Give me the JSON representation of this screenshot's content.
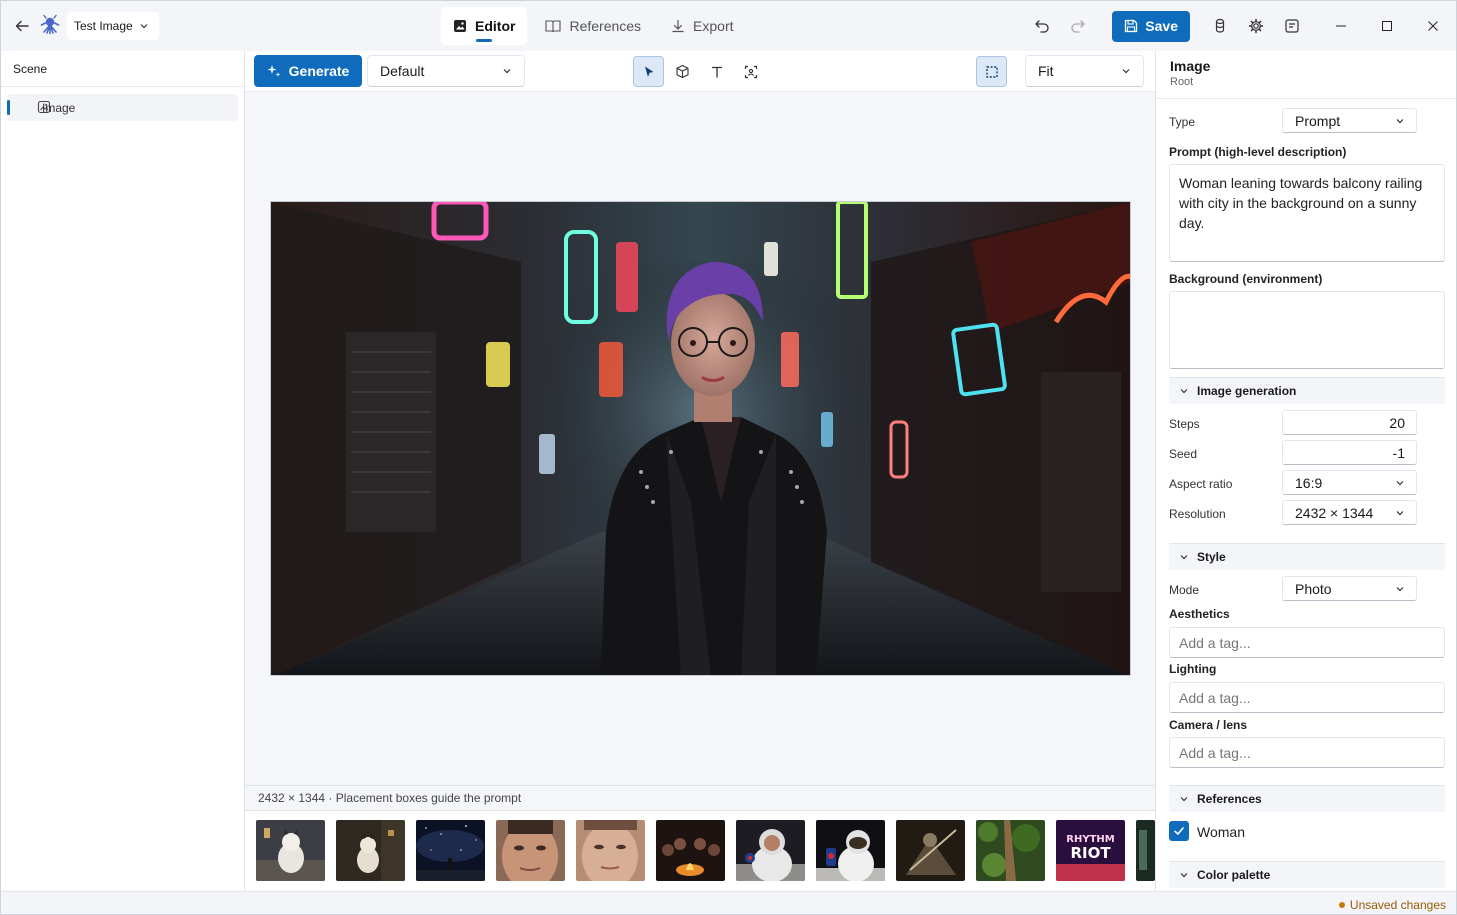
{
  "titlebar": {
    "document_name": "Test Image",
    "tabs": [
      {
        "label": "Editor",
        "icon": "image-icon",
        "active": true
      },
      {
        "label": "References",
        "icon": "book-icon",
        "active": false
      },
      {
        "label": "Export",
        "icon": "download-icon",
        "active": false
      }
    ],
    "save_label": "Save"
  },
  "scene": {
    "header": "Scene",
    "items": [
      {
        "label": "Image",
        "icon": "image-icon"
      }
    ]
  },
  "toolbar": {
    "generate_label": "Generate",
    "preset": "Default",
    "zoom": "Fit",
    "tools": [
      "select-tool",
      "box-tool",
      "text-tool",
      "subject-tool"
    ]
  },
  "canvas": {
    "status": "2432 × 1344 · Placement boxes guide the prompt"
  },
  "properties": {
    "title": "Image",
    "subtitle": "Root",
    "type_label": "Type",
    "type_value": "Prompt",
    "prompt_label": "Prompt (high-level description)",
    "prompt_value": "Woman leaning towards balcony railing with city in the background on a sunny day.",
    "background_label": "Background (environment)",
    "background_value": "",
    "image_generation": {
      "title": "Image generation",
      "steps_label": "Steps",
      "steps_value": "20",
      "seed_label": "Seed",
      "seed_value": "-1",
      "aspect_label": "Aspect ratio",
      "aspect_value": "16:9",
      "resolution_label": "Resolution",
      "resolution_value": "2432 × 1344"
    },
    "style": {
      "title": "Style",
      "mode_label": "Mode",
      "mode_value": "Photo",
      "aesthetics_label": "Aesthetics",
      "lighting_label": "Lighting",
      "camera_label": "Camera / lens",
      "tag_placeholder": "Add a tag..."
    },
    "references": {
      "title": "References",
      "items": [
        {
          "label": "Woman",
          "checked": true
        }
      ]
    },
    "color_palette": {
      "title": "Color palette"
    }
  },
  "status": {
    "unsaved": "Unsaved changes"
  },
  "colors": {
    "accent": "#0f6cbd",
    "unsaved": "#c27c0e"
  }
}
